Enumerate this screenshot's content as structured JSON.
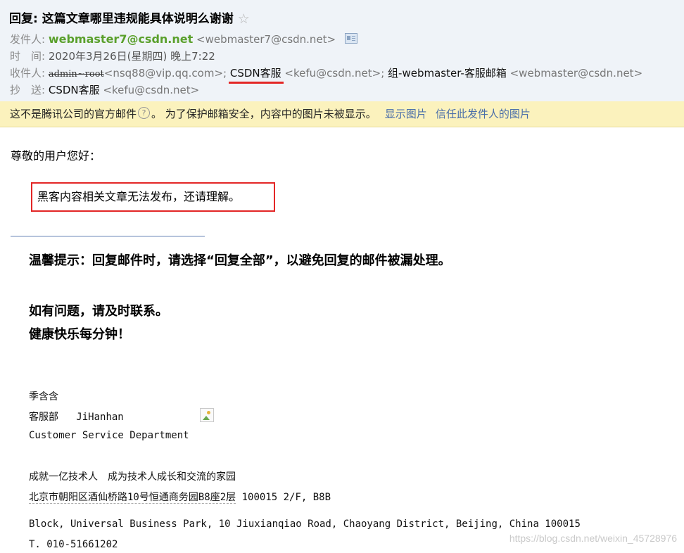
{
  "header": {
    "subject": "回复: 这篇文章哪里违规能具体说明么谢谢",
    "star_icon": "☆",
    "sender_label": "发件人:",
    "sender_name": "webmaster7@csdn.net",
    "sender_email": "<webmaster7@csdn.net>",
    "time_label": "时　间:",
    "time_value": "2020年3月26日(星期四) 晚上7:22",
    "to_label": "收件人:",
    "to_strike": "admin~root",
    "to_email1": "<nsq88@vip.qq.com>;",
    "to_name2": "CSDN客服",
    "to_email2": "<kefu@csdn.net>;",
    "to_name3": "组-webmaster-客服邮箱",
    "to_email3": "<webmaster@csdn.net>",
    "cc_label": "抄　送:",
    "cc_name": "CSDN客服",
    "cc_email": "<kefu@csdn.net>"
  },
  "notice": {
    "text_before": "这不是腾讯公司的官方邮件",
    "help_icon": "?",
    "text_after": "。 为了保护邮箱安全，内容中的图片未被显示。",
    "show_images": "显示图片",
    "trust_sender": "信任此发件人的图片"
  },
  "body": {
    "greeting": "尊敬的用户您好：",
    "boxed_message": "黑客内容相关文章无法发布，还请理解。",
    "tip": "温馨提示：回复邮件时，请选择“回复全部”，以避免回复的邮件被漏处理。",
    "contact": "如有问题，请及时联系。",
    "wish": "健康快乐每分钟！"
  },
  "signature": {
    "name_cn": "季含含",
    "dept_cn": "客服部",
    "name_en": "JiHanhan",
    "dept_en": "Customer Service Department",
    "slogan": "成就一亿技术人　成为技术人成长和交流的家园",
    "address_cn": "北京市朝阳区酒仙桥路10号恒通商务园B8座2层",
    "address_code": "100015 2/F, B8B",
    "address_en": "Block, Universal Business Park, 10 Jiuxianqiao Road, Chaoyang District, Beijing, China 100015",
    "phone": "T. 010-51661202"
  },
  "watermark": "https://blog.csdn.net/weixin_45728976",
  "colors": {
    "header_bg": "#eff3f8",
    "notice_bg": "#fbf2bd",
    "highlight_red": "#e32626",
    "sender_green": "#5aa02c",
    "link_blue": "#4a6ea9"
  }
}
